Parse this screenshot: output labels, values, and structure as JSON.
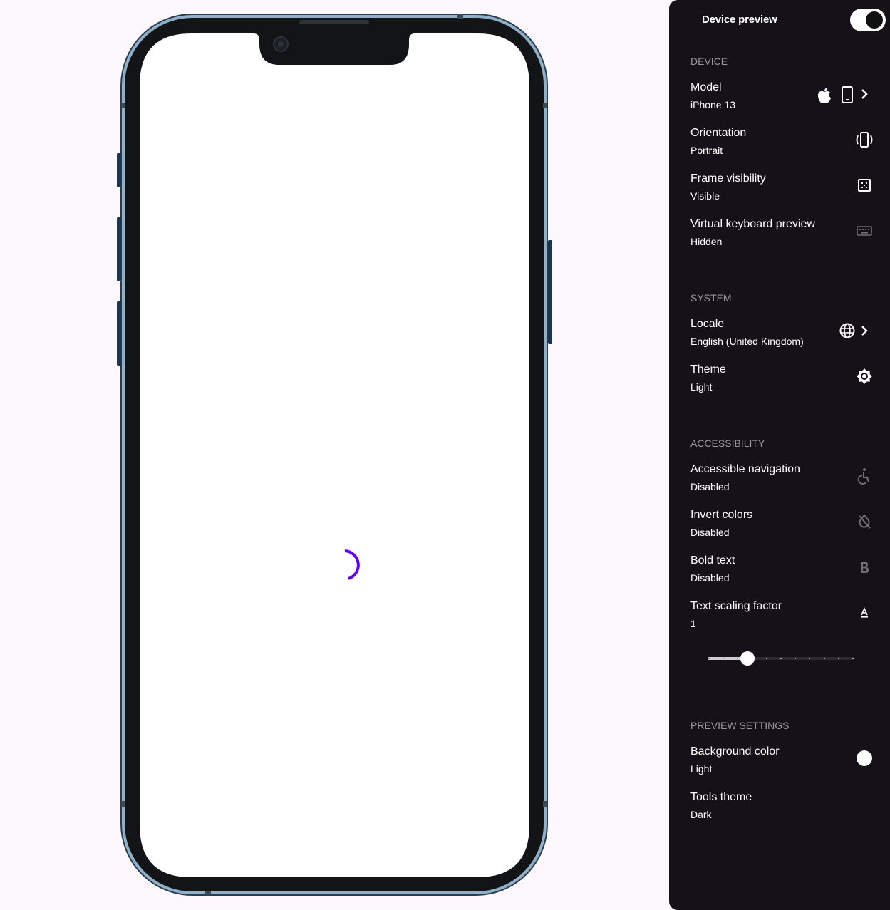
{
  "header": {
    "title": "Device preview",
    "toggle_on": true
  },
  "sections": {
    "device": {
      "title": "DEVICE",
      "model": {
        "title": "Model",
        "value": "iPhone 13"
      },
      "orientation": {
        "title": "Orientation",
        "value": "Portrait"
      },
      "frame": {
        "title": "Frame visibility",
        "value": "Visible"
      },
      "keyboard": {
        "title": "Virtual keyboard preview",
        "value": "Hidden"
      }
    },
    "system": {
      "title": "SYSTEM",
      "locale": {
        "title": "Locale",
        "value": "English (United Kingdom)"
      },
      "theme": {
        "title": "Theme",
        "value": "Light"
      }
    },
    "accessibility": {
      "title": "ACCESSIBILITY",
      "nav": {
        "title": "Accessible navigation",
        "value": "Disabled"
      },
      "invert": {
        "title": "Invert colors",
        "value": "Disabled"
      },
      "bold": {
        "title": "Bold text",
        "value": "Disabled"
      },
      "scaling": {
        "title": "Text scaling factor",
        "value": "1",
        "slider_fraction": 0.27,
        "slider_steps": 11
      }
    },
    "preview": {
      "title": "PREVIEW SETTINGS",
      "background": {
        "title": "Background color",
        "value": "Light"
      },
      "tools": {
        "title": "Tools theme",
        "value": "Dark"
      }
    }
  },
  "icons": {
    "model": [
      "apple-icon",
      "smartphone-icon",
      "chevron-right-icon"
    ],
    "orientation": "screen-rotation-icon",
    "frame": "frame-grid-icon",
    "keyboard": "keyboard-icon",
    "locale": [
      "globe-icon",
      "chevron-right-icon"
    ],
    "theme": "brightness-icon",
    "nav": "accessible-icon",
    "invert": "invert-colors-off-icon",
    "bold": "bold-icon",
    "scaling": "text-scale-icon",
    "background": "circle-icon"
  },
  "colors": {
    "panel_bg": "#141218",
    "stage_bg": "#fdf7fe",
    "spinner": "#6200ee",
    "phone_frame": "#8fb0c8",
    "muted": "#9a98a0"
  }
}
